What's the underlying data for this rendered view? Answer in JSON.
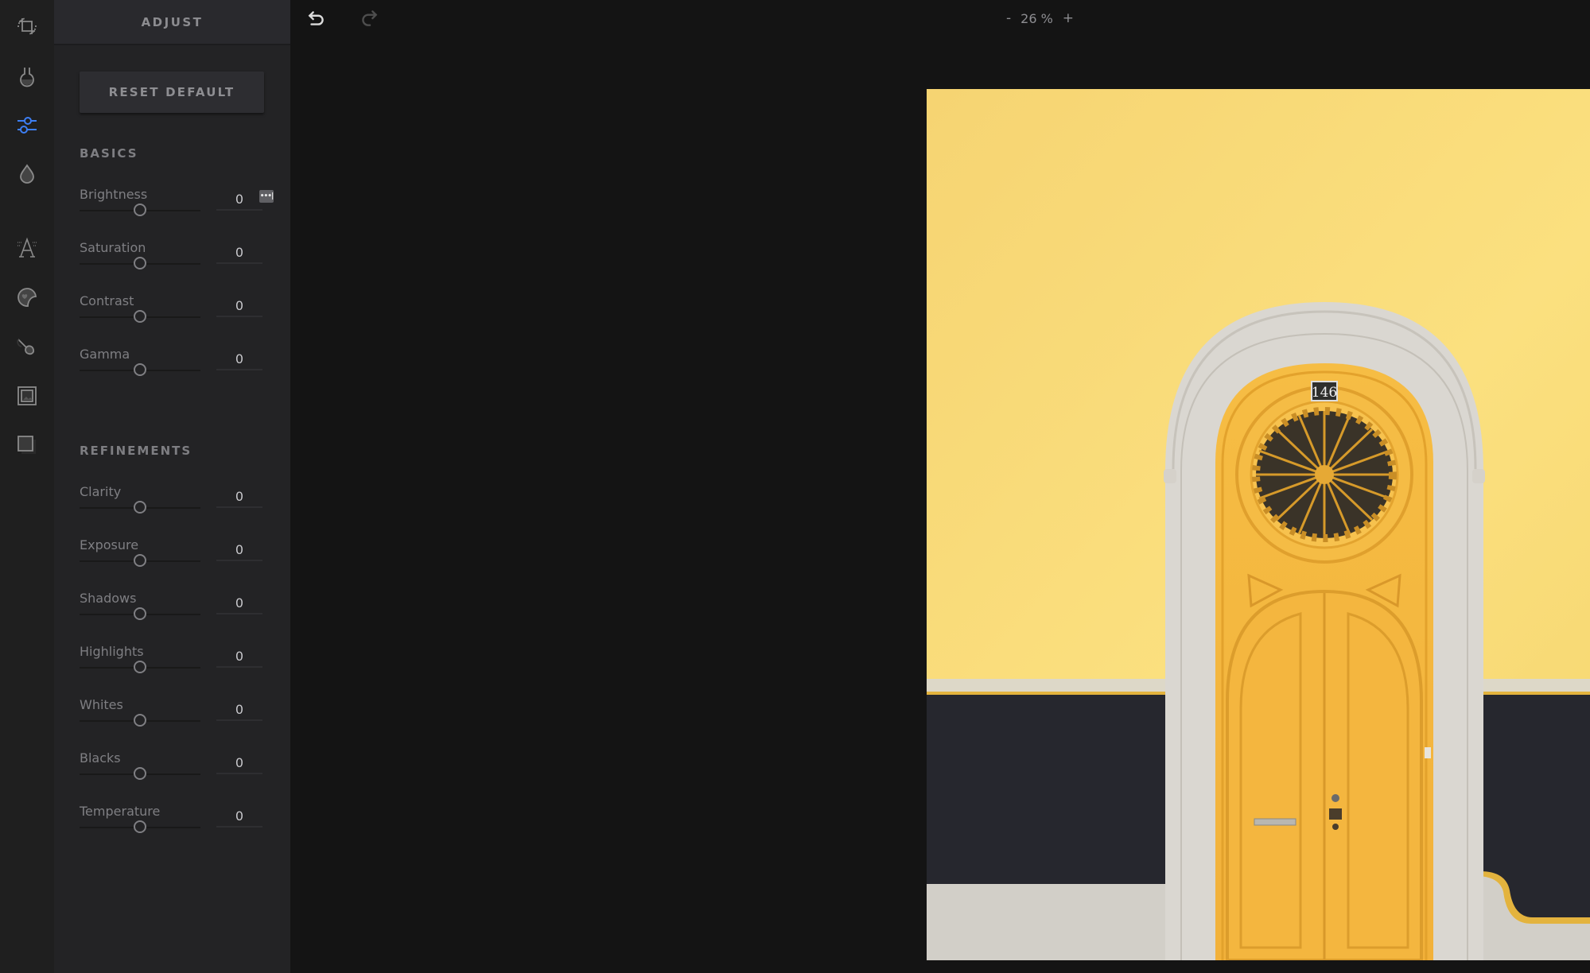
{
  "rail": {
    "items": [
      {
        "name": "crop-rotate",
        "icon": "crop-icon",
        "active": false
      },
      {
        "name": "filters",
        "icon": "flask-icon",
        "active": false
      },
      {
        "name": "adjust",
        "icon": "sliders-icon",
        "active": true
      },
      {
        "name": "color",
        "icon": "droplet-icon",
        "active": false
      },
      {
        "name": "text",
        "icon": "text-icon",
        "active": false
      },
      {
        "name": "stickers",
        "icon": "sticker-icon",
        "active": false
      },
      {
        "name": "brush",
        "icon": "brush-icon",
        "active": false
      },
      {
        "name": "frames",
        "icon": "frame-icon",
        "active": false
      },
      {
        "name": "overlay",
        "icon": "overlay-icon",
        "active": false
      }
    ],
    "accent_color": "#3d7ff5"
  },
  "panel": {
    "title": "ADJUST",
    "reset_label": "RESET DEFAULT",
    "sections": [
      {
        "title": "BASICS",
        "controls": [
          {
            "label": "Brightness",
            "value": "0",
            "position": 0.5
          },
          {
            "label": "Saturation",
            "value": "0",
            "position": 0.5
          },
          {
            "label": "Contrast",
            "value": "0",
            "position": 0.5
          },
          {
            "label": "Gamma",
            "value": "0",
            "position": 0.5
          }
        ]
      },
      {
        "title": "REFINEMENTS",
        "controls": [
          {
            "label": "Clarity",
            "value": "0",
            "position": 0.5
          },
          {
            "label": "Exposure",
            "value": "0",
            "position": 0.5
          },
          {
            "label": "Shadows",
            "value": "0",
            "position": 0.5
          },
          {
            "label": "Highlights",
            "value": "0",
            "position": 0.5
          },
          {
            "label": "Whites",
            "value": "0",
            "position": 0.5
          },
          {
            "label": "Blacks",
            "value": "0",
            "position": 0.5
          },
          {
            "label": "Temperature",
            "value": "0",
            "position": 0.5
          }
        ]
      }
    ]
  },
  "toolbar": {
    "undo_icon": "undo-icon",
    "redo_icon": "redo-icon",
    "zoom_minus": "-",
    "zoom_level": "26 %",
    "zoom_plus": "+"
  },
  "photo": {
    "subject": "yellow arched door on yellow wall",
    "house_number": "146",
    "colors": {
      "wall": "#f7d56d",
      "door": "#f3b63a",
      "stone": "#d9d6d0",
      "base": "#27282f"
    }
  }
}
